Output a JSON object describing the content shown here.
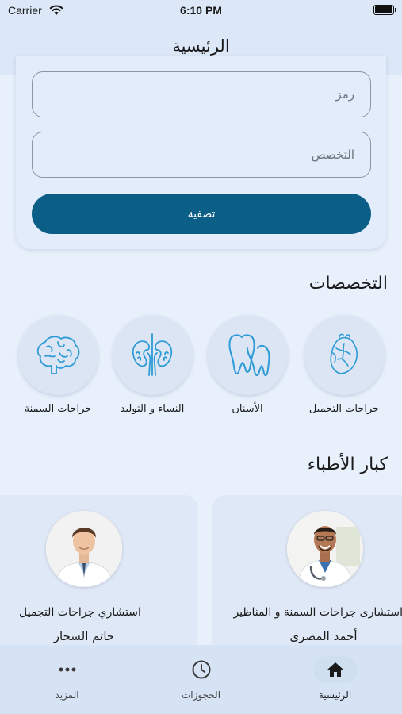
{
  "status_bar": {
    "carrier": "Carrier",
    "time": "6:10 PM"
  },
  "nav": {
    "title": "الرئيسية"
  },
  "filter": {
    "code_placeholder": "رمز",
    "specialty_placeholder": "التخصص",
    "filter_button": "تصفية"
  },
  "specialties_section": {
    "title": "التخصصات",
    "items": [
      {
        "label": "جراحات التجميل",
        "icon": "heart-icon"
      },
      {
        "label": "الأسنان",
        "icon": "tooth-icon"
      },
      {
        "label": "النساء و التوليد",
        "icon": "kidneys-icon"
      },
      {
        "label": "جراحات السمنة",
        "icon": "brain-icon"
      }
    ]
  },
  "doctors_section": {
    "title": "كبار الأطباء",
    "doctors": [
      {
        "title": "استشارى جراحات السمنة و المناظير",
        "name": "أحمد المصرى"
      },
      {
        "title": "استشاري جراحات التجميل",
        "name": "حاتم السحار"
      }
    ]
  },
  "tab_bar": {
    "home": "الرئيسية",
    "bookings": "الحجوزات",
    "more": "المزيد"
  },
  "colors": {
    "primary": "#0b5f86",
    "icon_blue": "#2d9bd6",
    "background": "#e8f0fc"
  }
}
